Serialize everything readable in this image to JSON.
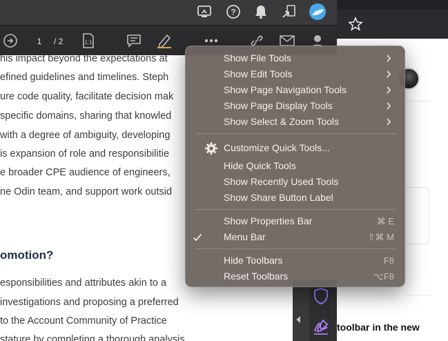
{
  "document": {
    "lines": [
      "his impact beyond the expectations at",
      "efined guidelines and timelines. Steph",
      "ure code quality, facilitate decision mak",
      "specific domains, sharing that knowled",
      " with a degree of ambiguity, developing",
      "is expansion of role and responsibilitie",
      "e broader CPE audience of engineers,",
      "ne Odin team, and support work outsid"
    ],
    "heading": "omotion?",
    "lines_after": [
      "esponsibilities and attributes akin to a",
      "investigations and proposing a preferred",
      " to the Account Community of Practice",
      " stature by completing a thorough analysis"
    ]
  },
  "toolbar": {
    "page_current": "1",
    "page_total": "/ 2",
    "more_icon": "ellipsis-icon"
  },
  "menu": {
    "groups": [
      [
        {
          "label": "Show File Tools",
          "submenu": true
        },
        {
          "label": "Show Edit Tools",
          "submenu": true
        },
        {
          "label": "Show Page Navigation Tools",
          "submenu": true
        },
        {
          "label": "Show Page Display Tools",
          "submenu": true
        },
        {
          "label": "Show Select & Zoom Tools",
          "submenu": true
        }
      ],
      [
        {
          "label": "Customize Quick Tools...",
          "icon": "gear-icon"
        },
        {
          "label": "Hide Quick Tools"
        },
        {
          "label": "Show Recently Used Tools"
        },
        {
          "label": "Show Share Button Label"
        }
      ],
      [
        {
          "label": "Show Properties Bar",
          "shortcut": "⌘ E"
        },
        {
          "label": "Menu Bar",
          "shortcut": "⇧⌘ M",
          "checked": true
        }
      ],
      [
        {
          "label": "Hide Toolbars",
          "shortcut": "F8"
        },
        {
          "label": "Reset Toolbars",
          "shortcut": "⌥F8"
        }
      ]
    ]
  },
  "browser": {
    "partial_text": "toolbar in the new"
  },
  "colors": {
    "menu_bg": "#6e6660",
    "toolbar_dark": "#3a3a3c",
    "accent_blue": "#4aa8e8",
    "accent_purple": "#9b6dff"
  }
}
